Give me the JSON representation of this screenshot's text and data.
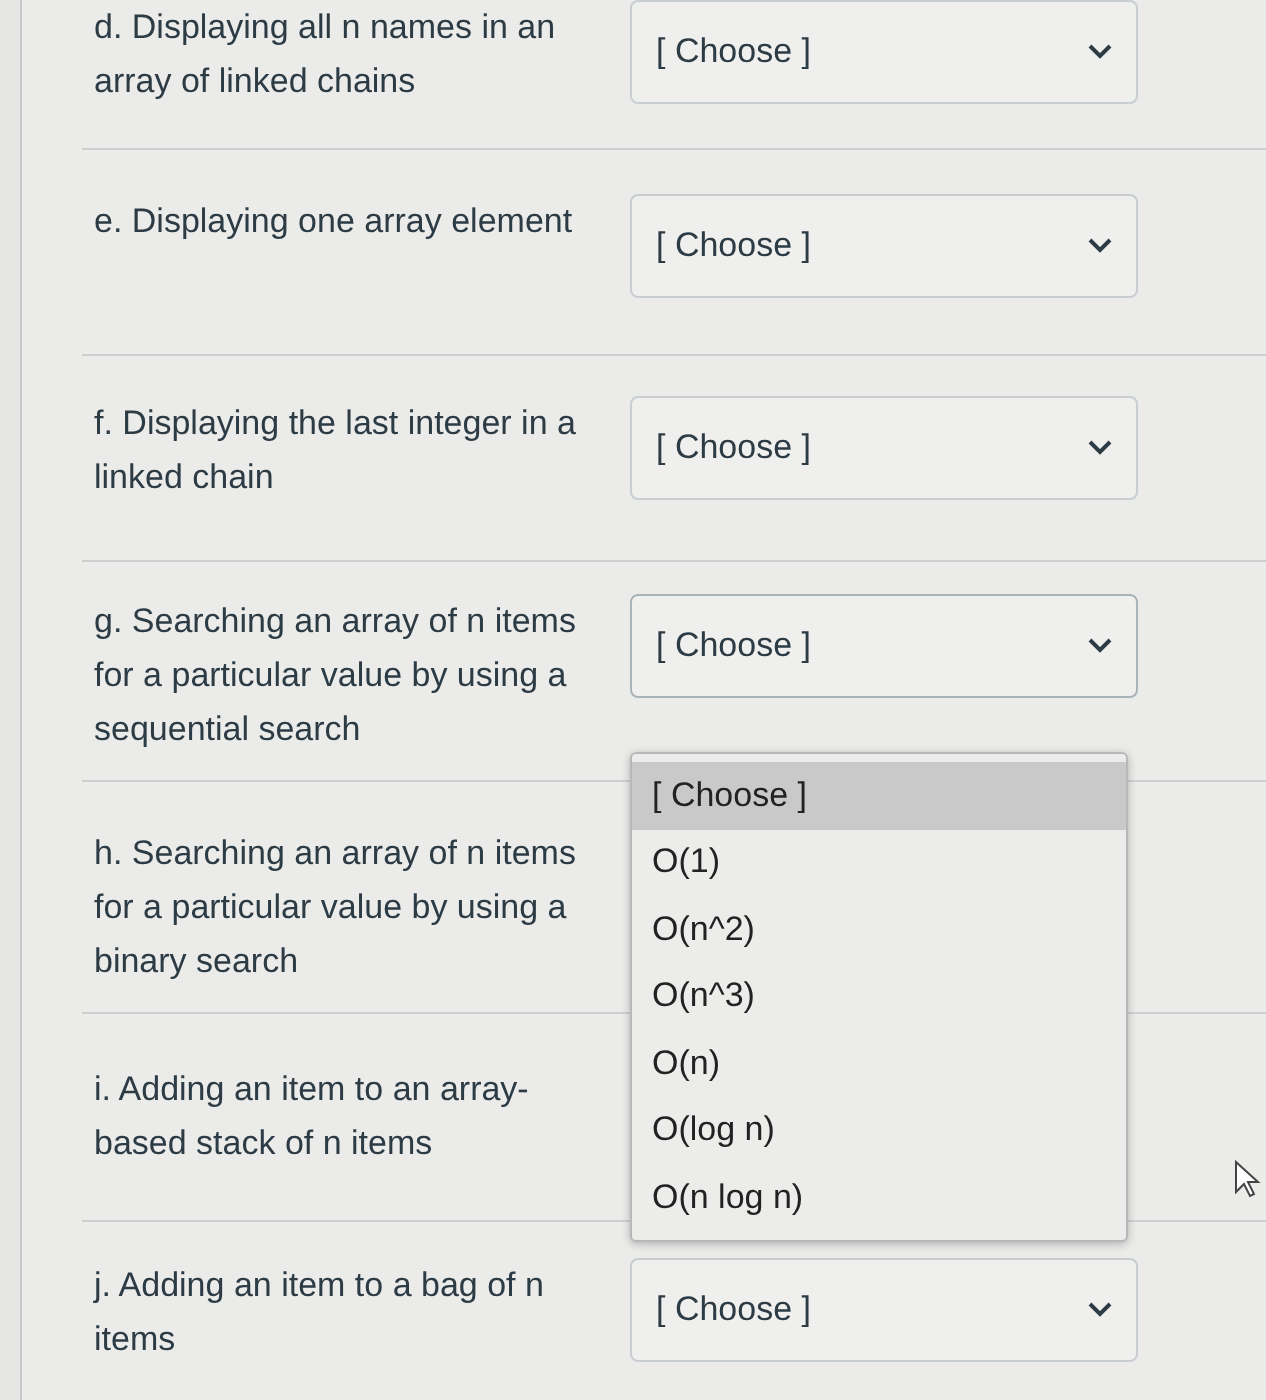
{
  "questions": [
    {
      "label": "d. Displaying all n names in an array of linked chains",
      "select": {
        "value": "[ Choose ]"
      }
    },
    {
      "label": "e. Displaying one array element",
      "select": {
        "value": "[ Choose ]"
      }
    },
    {
      "label": "f. Displaying the last integer in a linked chain",
      "select": {
        "value": "[ Choose ]"
      }
    },
    {
      "label": "g. Searching an array of n items for a particular value by using a sequential search",
      "select": {
        "value": "[ Choose ]",
        "open": true,
        "options": [
          {
            "label": "[ Choose ]",
            "selected": true
          },
          {
            "label": "O(1)",
            "selected": false
          },
          {
            "label": "O(n^2)",
            "selected": false
          },
          {
            "label": "O(n^3)",
            "selected": false
          },
          {
            "label": "O(n)",
            "selected": false
          },
          {
            "label": "O(log n)",
            "selected": false
          },
          {
            "label": "O(n log n)",
            "selected": false
          }
        ]
      }
    },
    {
      "label": "h. Searching an array of n items for a particular value by using a binary search"
    },
    {
      "label": "i. Adding an item to an array-based stack of n items"
    },
    {
      "label": "j. Adding an item to a bag of n items",
      "select": {
        "value": "[ Choose ]"
      }
    }
  ]
}
